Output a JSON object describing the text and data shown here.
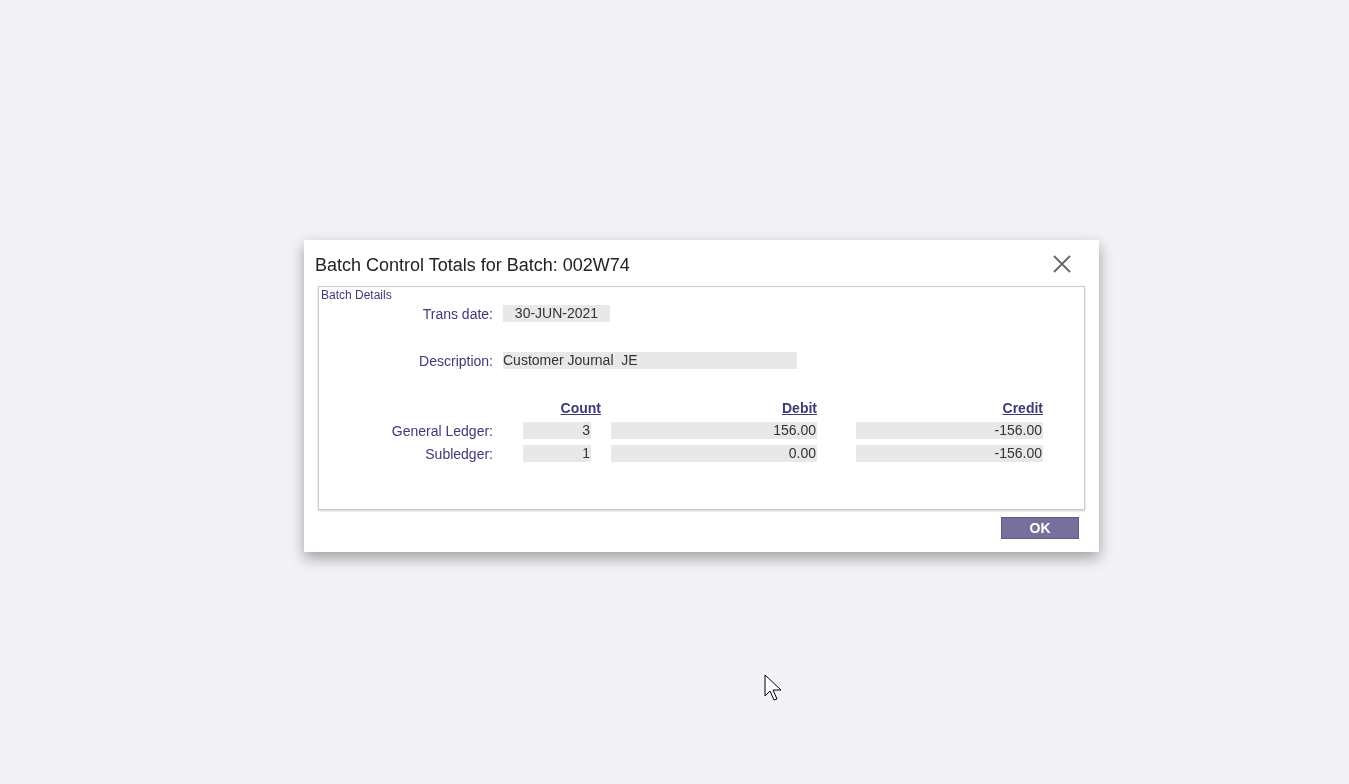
{
  "dialog": {
    "title": "Batch Control Totals for Batch: 002W74"
  },
  "group": {
    "title": "Batch Details"
  },
  "trans_date": {
    "label": "Trans date:",
    "value": "30-JUN-2021"
  },
  "description": {
    "label": "Description:",
    "value": "Customer Journal  JE"
  },
  "columns": [
    "Count",
    "Debit",
    "Credit"
  ],
  "rows": [
    {
      "label": "General Ledger:",
      "count": "3",
      "debit": "156.00",
      "credit": "-156.00"
    },
    {
      "label": "Subledger:",
      "count": "1",
      "debit": "0.00",
      "credit": "-156.00"
    }
  ],
  "buttons": [
    "OK"
  ]
}
